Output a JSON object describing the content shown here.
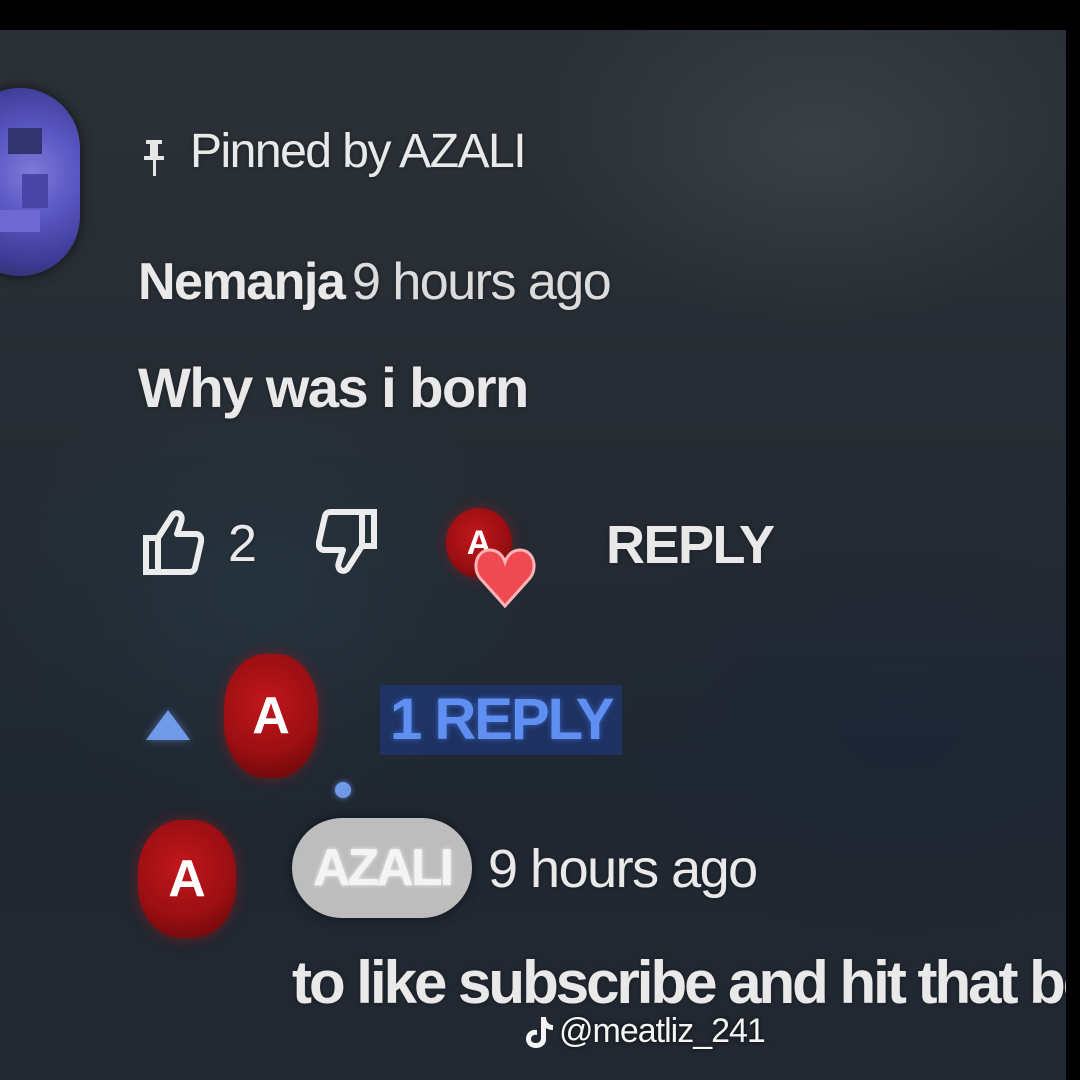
{
  "comment": {
    "pinned_label": "Pinned by AZALI",
    "author": "Nemanja",
    "timestamp": "9 hours ago",
    "text": "Why was i born",
    "like_count": "2",
    "reply_button_label": "REPLY",
    "liked_by_creator_badge_letter": "A"
  },
  "replies": {
    "toggle_label": "1 REPLY",
    "creator_avatar_letter": "A"
  },
  "reply": {
    "avatar_letter": "A",
    "author": "AZALI",
    "timestamp": "9 hours ago",
    "text": "to like subscribe and hit that bell"
  },
  "watermark": {
    "handle": "@meatliz_241",
    "icon": "tiktok-icon"
  },
  "colors": {
    "link_blue": "#5f8ff0",
    "creator_red": "#b3121a",
    "heart_red": "#f0484f",
    "avatar_purple": "#5b57c4",
    "chip_gray": "#bdbdbd"
  },
  "icons": [
    "pin-icon",
    "thumbs-up-icon",
    "thumbs-down-icon",
    "heart-icon",
    "caret-up-icon"
  ]
}
